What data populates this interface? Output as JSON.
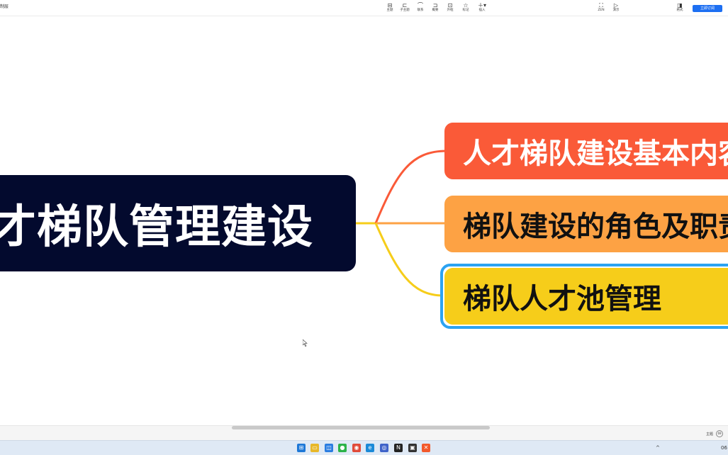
{
  "toolbar": {
    "doc_title": "制层",
    "tools": [
      {
        "icon": "topic-icon",
        "glyph": "⊟",
        "label": "主题"
      },
      {
        "icon": "subtopic-icon",
        "glyph": "⊏",
        "label": "子主题"
      },
      {
        "icon": "relation-icon",
        "glyph": "⌒",
        "label": "联系"
      },
      {
        "icon": "summary-icon",
        "glyph": "⊐",
        "label": "概要"
      },
      {
        "icon": "boundary-icon",
        "glyph": "⊡",
        "label": "外框"
      },
      {
        "icon": "marker-icon",
        "glyph": "☆",
        "label": "标记"
      },
      {
        "icon": "insert-icon",
        "glyph": "＋▾",
        "label": "插入"
      }
    ],
    "right_tools": [
      {
        "icon": "zen-icon",
        "glyph": "⛶",
        "label": "ZEN"
      },
      {
        "icon": "present-icon",
        "glyph": "▷",
        "label": "演示"
      },
      {
        "icon": "format-icon",
        "glyph": "◨",
        "label": "格式"
      }
    ],
    "subscribe_label": "立即订阅"
  },
  "mindmap": {
    "root": "人才梯队管理建设",
    "branches": [
      {
        "text": "人才梯队建设基本内容",
        "color": "#fa5a38"
      },
      {
        "text": "梯队建设的角色及职责",
        "color": "#fda244"
      },
      {
        "text": "梯队人才池管理",
        "color": "#f6cd1a"
      }
    ],
    "selection_color": "#2ba3f2",
    "root_color": "#030a2e"
  },
  "statusbar": {
    "topic_label": "主题",
    "zoom_badge": "69"
  },
  "taskbar": {
    "apps": [
      {
        "icon": "windows-start-icon",
        "color": "#1e78d7",
        "glyph": "⊞"
      },
      {
        "icon": "file-explorer-icon",
        "color": "#e8b82a",
        "glyph": "▭"
      },
      {
        "icon": "store-icon",
        "color": "#2a7de1",
        "glyph": "◫"
      },
      {
        "icon": "wechat-icon",
        "color": "#2cb34a",
        "glyph": "●"
      },
      {
        "icon": "chrome-icon",
        "color": "#e04a3a",
        "glyph": "◉"
      },
      {
        "icon": "edge-icon",
        "color": "#1b8ad8",
        "glyph": "e"
      },
      {
        "icon": "browser-icon",
        "color": "#3f63c9",
        "glyph": "◎"
      },
      {
        "icon": "notion-icon",
        "color": "#222222",
        "glyph": "N"
      },
      {
        "icon": "media-icon",
        "color": "#333333",
        "glyph": "▣"
      },
      {
        "icon": "xmind-icon",
        "color": "#f2592b",
        "glyph": "✕"
      }
    ],
    "tray": {
      "chevron": "^",
      "time": "06"
    }
  }
}
